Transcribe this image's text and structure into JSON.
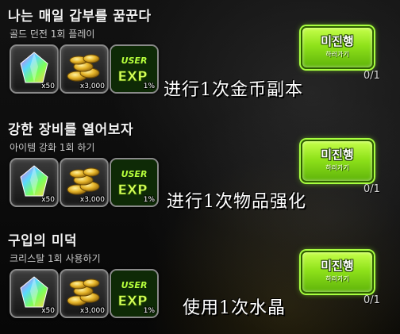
{
  "quests": [
    {
      "title": "나는 매일 갑부를 꿈꾼다",
      "subtitle": "골드 던전 1회 플레이",
      "rewards": [
        {
          "icon": "crystal-icon",
          "qty": "x50"
        },
        {
          "icon": "gold-coins-icon",
          "qty": "x3,000"
        },
        {
          "icon": "user-exp-icon",
          "qty": "1%"
        }
      ],
      "button_label": "미진행",
      "button_sub": "하러가기",
      "progress": "0/1",
      "caption": "进行1次金币副本"
    },
    {
      "title": "강한 장비를 열어보자",
      "subtitle": "아이템 강화 1회 하기",
      "rewards": [
        {
          "icon": "crystal-icon",
          "qty": "x50"
        },
        {
          "icon": "gold-coins-icon",
          "qty": "x3,000"
        },
        {
          "icon": "user-exp-icon",
          "qty": "1%"
        }
      ],
      "button_label": "미진행",
      "button_sub": "하러가기",
      "progress": "0/1",
      "caption": "进行1次物品强化"
    },
    {
      "title": "구입의 미덕",
      "subtitle": "크리스탈 1회 사용하기",
      "rewards": [
        {
          "icon": "crystal-icon",
          "qty": "x50"
        },
        {
          "icon": "gold-coins-icon",
          "qty": "x3,000"
        },
        {
          "icon": "user-exp-icon",
          "qty": "1%"
        }
      ],
      "button_label": "미진행",
      "button_sub": "하러가기",
      "progress": "0/1",
      "caption": "使用1次水晶"
    }
  ],
  "colors": {
    "button_green": "#8fe21a",
    "button_glow": "#a8ff40",
    "slot_border": "#8a8a8a",
    "background": "#0b0b0b"
  }
}
